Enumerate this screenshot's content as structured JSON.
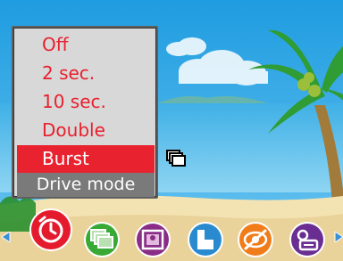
{
  "menu": {
    "items": [
      {
        "label": "Off",
        "selected": false
      },
      {
        "label": "2 sec.",
        "selected": false
      },
      {
        "label": "10 sec.",
        "selected": false
      },
      {
        "label": "Double",
        "selected": false
      },
      {
        "label": "Burst",
        "selected": true
      }
    ],
    "title": "Drive mode"
  },
  "indicator": {
    "icon": "burst-drive-icon"
  },
  "icon_bar": {
    "icons": [
      {
        "name": "self-timer-icon",
        "color": "#e41b2d",
        "active": true
      },
      {
        "name": "drive-mode-icon",
        "color": "#39a935"
      },
      {
        "name": "image-size-icon",
        "color": "#8a2d86"
      },
      {
        "name": "image-quality-icon",
        "color": "#2a8ad0"
      },
      {
        "name": "flash-off-icon",
        "color": "#f07d1a"
      },
      {
        "name": "date-stamp-icon",
        "color": "#6a2d92"
      }
    ]
  },
  "colors": {
    "selection": "#e9222f",
    "menu_text": "#e8202e"
  }
}
